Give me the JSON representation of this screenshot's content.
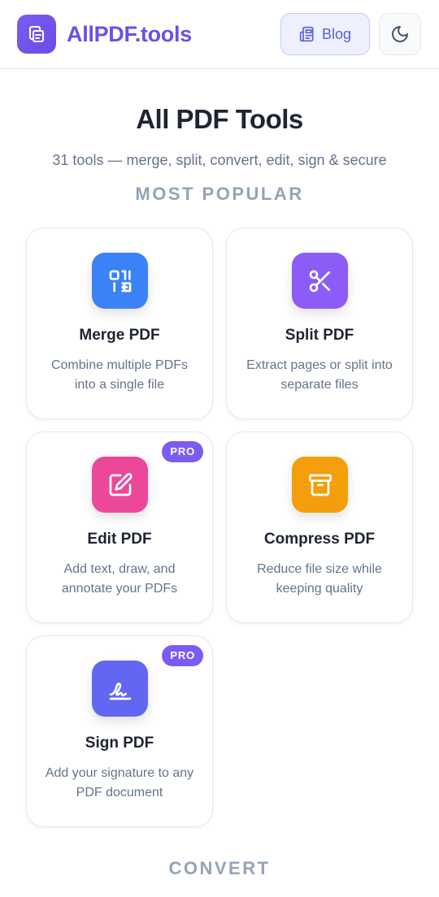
{
  "header": {
    "brand": "AllPDF.tools",
    "blog_label": "Blog",
    "logo_icon": "copy-documents-icon",
    "blog_icon": "newspaper-icon",
    "theme_icon": "moon-icon"
  },
  "main": {
    "title": "All PDF Tools",
    "subtitle": "31 tools — merge, split, convert, edit, sign & secure"
  },
  "sections": {
    "popular": {
      "heading": "MOST POPULAR"
    },
    "convert": {
      "heading": "CONVERT"
    }
  },
  "tools": [
    {
      "title": "Merge PDF",
      "desc": "Combine multiple PDFs into a single file",
      "color": "#3b82f6",
      "icon": "merge-icon",
      "pro": ""
    },
    {
      "title": "Split PDF",
      "desc": "Extract pages or split into separate files",
      "color": "#8b5cf6",
      "icon": "scissors-icon",
      "pro": ""
    },
    {
      "title": "Edit PDF",
      "desc": "Add text, draw, and annotate your PDFs",
      "color": "#ec4899",
      "icon": "edit-icon",
      "pro": "PRO"
    },
    {
      "title": "Compress PDF",
      "desc": "Reduce file size while keeping quality",
      "color": "#f59e0b",
      "icon": "archive-icon",
      "pro": ""
    },
    {
      "title": "Sign PDF",
      "desc": "Add your signature to any PDF document",
      "color": "#6366f1",
      "icon": "signature-icon",
      "pro": "PRO"
    }
  ],
  "colors": {
    "brand": "#6d4ee8",
    "pro_badge": "#7c5cf0"
  }
}
